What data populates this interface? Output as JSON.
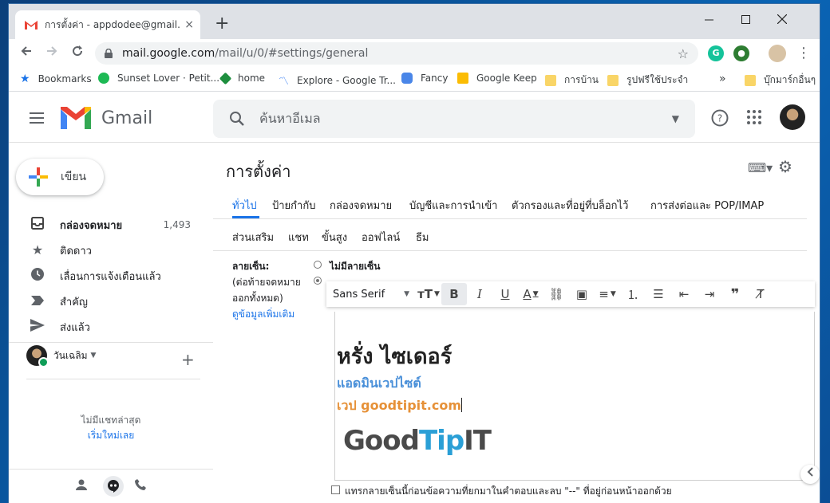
{
  "browser": {
    "tab_title": "การตั้งค่า - appdodee@gmail.com",
    "tab_close": "×",
    "new_tab": "+",
    "url_host": "mail.google.com",
    "url_path": "/mail/u/0/#settings/general",
    "bookmarks": [
      {
        "label": "Bookmarks",
        "color": "#1a73e8"
      },
      {
        "label": "Sunset Lover · Petit...",
        "color": "#1db954"
      },
      {
        "label": "home",
        "color": "#1e8e3e"
      },
      {
        "label": "Explore - Google Tr...",
        "color": "#4285f4"
      },
      {
        "label": "Fancy",
        "color": "#4a86e8"
      },
      {
        "label": "Google Keep",
        "color": "#fbbc04"
      },
      {
        "label": "การบ้าน",
        "color": "#f9d567"
      },
      {
        "label": "รูปฟรีใช้ประจำ",
        "color": "#f9d567"
      }
    ],
    "bookmarks_more": "»",
    "other_bookmarks": "บุ๊กมาร์กอื่นๆ"
  },
  "gmail": {
    "brand": "Gmail",
    "search_placeholder": "ค้นหาอีเมล",
    "compose_label": "เขียน",
    "nav": [
      {
        "label": "กล่องจดหมาย",
        "count": "1,493",
        "icon": "inbox-icon"
      },
      {
        "label": "ติดดาว",
        "count": "",
        "icon": "star-icon"
      },
      {
        "label": "เลื่อนการแจ้งเตือนแล้ว",
        "count": "",
        "icon": "clock-icon"
      },
      {
        "label": "สำคัญ",
        "count": "",
        "icon": "important-icon"
      },
      {
        "label": "ส่งแล้ว",
        "count": "",
        "icon": "send-icon"
      }
    ],
    "chat_user": "วันเฉลิม",
    "chat_empty": "ไม่มีแชทล่าสุด",
    "chat_start": "เริ่มใหม่เลย"
  },
  "settings": {
    "title": "การตั้งค่า",
    "tabs_row1": [
      "ทั่วไป",
      "ป้ายกำกับ",
      "กล่องจดหมาย",
      "บัญชีและการนำเข้า",
      "ตัวกรองและที่อยู่ที่บล็อกไว้",
      "การส่งต่อและ POP/IMAP"
    ],
    "tabs_row2": [
      "ส่วนเสริม",
      "แชท",
      "ขั้นสูง",
      "ออฟไลน์",
      "ธีม"
    ],
    "signature_label": "ลายเซ็น:",
    "signature_note1": "(ต่อท้ายจดหมาย",
    "signature_note2": "ออกทั้งหมด)",
    "learn_more": "ดูข้อมูลเพิ่มเติม",
    "no_signature": "ไม่มีลายเซ็น",
    "font_name": "Sans Serif",
    "signature": {
      "name": "หรั่ง ไซเดอร์",
      "role": "แอดมินเวปไซต์",
      "website": "เวป goodtipit.com",
      "logo_part1": "Good",
      "logo_part2": "Tip",
      "logo_part3": "IT"
    },
    "insert_checkbox": "แทรกลายเซ็นนี้ก่อนข้อความที่ยกมาในคำตอบและลบ \"--\" ที่อยู่ก่อนหน้าออกด้วย"
  }
}
